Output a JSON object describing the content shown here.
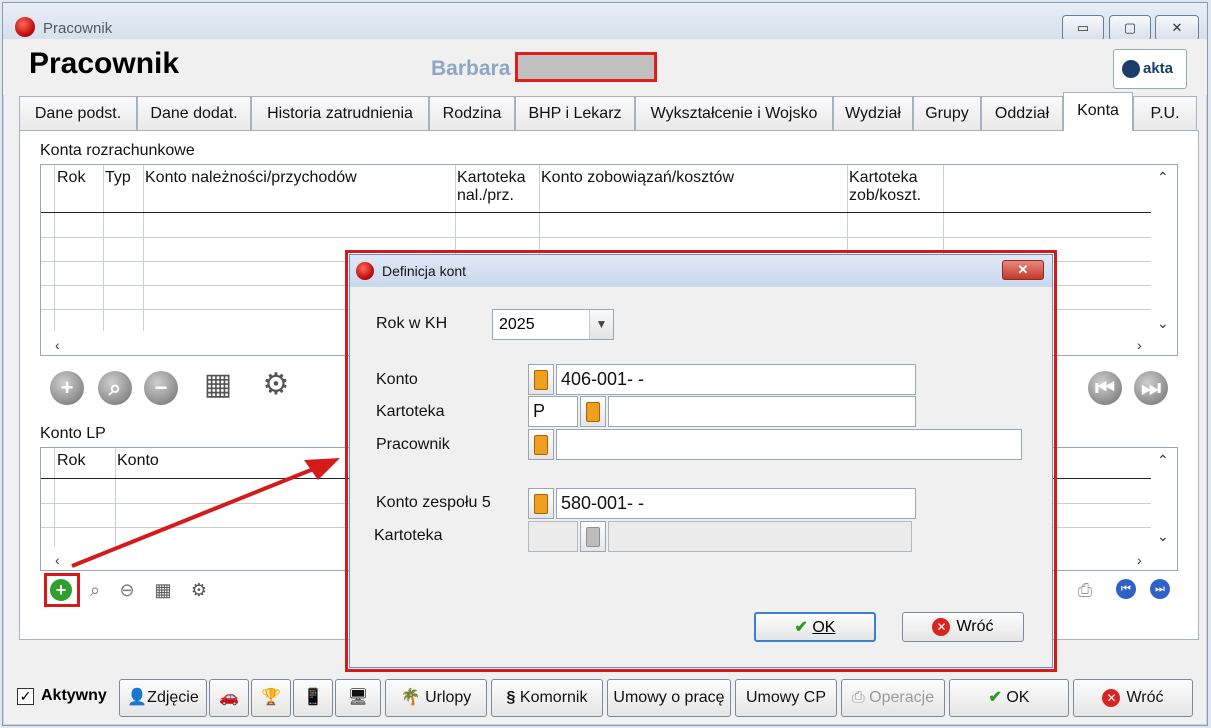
{
  "window": {
    "title": "Pracownik",
    "minimize": "▭",
    "maximize": "▢",
    "close": "✕"
  },
  "header": {
    "title": "Pracownik",
    "employee_name": "Barbara",
    "logo_text": "akta"
  },
  "tabs": [
    "Dane podst.",
    "Dane dodat.",
    "Historia zatrudnienia",
    "Rodzina",
    "BHP i Lekarz",
    "Wykształcenie i Wojsko",
    "Wydział",
    "Grupy",
    "Oddział",
    "Konta",
    "P.U."
  ],
  "konta_section": {
    "label": "Konta rozrachunkowe",
    "columns": [
      "Rok",
      "Typ",
      "Konto należności/przychodów",
      "Kartoteka nal./prz.",
      "Konto zobowiązań/kosztów",
      "Kartoteka zob/koszt."
    ]
  },
  "kontolp_section": {
    "label": "Konto LP",
    "columns": [
      "Rok",
      "Konto"
    ]
  },
  "bottom": {
    "aktywny": "Aktywny",
    "zdjecie": "Zdjęcie",
    "urlopy": "Urlopy",
    "komornik": "Komornik",
    "umowy_o_prace": "Umowy o pracę",
    "umowy_cp": "Umowy CP",
    "operacje": "Operacje",
    "ok": "OK",
    "wroc": "Wróć"
  },
  "dialog": {
    "title": "Definicja kont",
    "rok_label": "Rok w KH",
    "rok_value": "2025",
    "konto_label": "Konto",
    "konto_value": "406-001-   -",
    "kartoteka_label": "Kartoteka",
    "kartoteka_prefix": "P",
    "kartoteka_value": "",
    "pracownik_label": "Pracownik",
    "pracownik_value": "",
    "konto_zespolu_label": "Konto zespołu 5",
    "konto_zespolu_value": "580-001-   -",
    "kartoteka2_label": "Kartoteka",
    "ok": "OK",
    "wroc": "Wróć"
  },
  "colors": {
    "accent_red": "#d41a1a",
    "tab_border": "#a8b1bd",
    "name_blue": "#8ea6c6"
  }
}
